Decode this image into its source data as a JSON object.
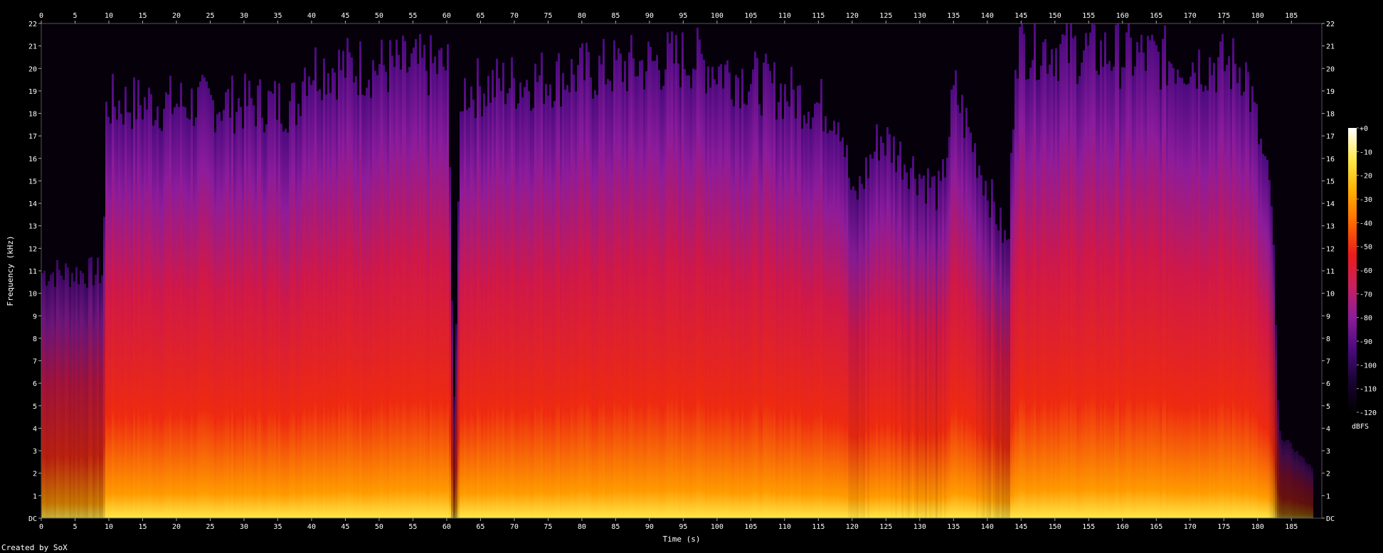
{
  "chart_data": {
    "type": "heatmap",
    "title": "",
    "xlabel": "Time (s)",
    "ylabel": "Frequency (kHz)",
    "xlim": [
      0,
      189.5
    ],
    "ylim": [
      0,
      22
    ],
    "x_ticks": [
      "0",
      "5",
      "10",
      "15",
      "20",
      "25",
      "30",
      "35",
      "40",
      "45",
      "50",
      "55",
      "60",
      "65",
      "70",
      "75",
      "80",
      "85",
      "90",
      "95",
      "100",
      "105",
      "110",
      "115",
      "120",
      "125",
      "130",
      "135",
      "140",
      "145",
      "150",
      "155",
      "160",
      "165",
      "170",
      "175",
      "180",
      "185"
    ],
    "y_ticks": [
      "DC",
      "1",
      "2",
      "3",
      "4",
      "5",
      "6",
      "7",
      "8",
      "9",
      "10",
      "11",
      "12",
      "13",
      "14",
      "15",
      "16",
      "17",
      "18",
      "19",
      "20",
      "21",
      "22"
    ],
    "colorbar": {
      "label": "dBFS",
      "ticks": [
        "+0",
        "-10",
        "-20",
        "-30",
        "-40",
        "-50",
        "-60",
        "-70",
        "-80",
        "-90",
        "-100",
        "-110",
        "-120"
      ],
      "range": [
        -120,
        0
      ]
    },
    "energy_profile": [
      {
        "t": 0,
        "level": 0.45
      },
      {
        "t": 9,
        "level": 0.45
      },
      {
        "t": 9.5,
        "level": 0.82
      },
      {
        "t": 38,
        "level": 0.82
      },
      {
        "t": 38.5,
        "level": 0.9
      },
      {
        "t": 60,
        "level": 0.9
      },
      {
        "t": 61,
        "level": 0.15
      },
      {
        "t": 62,
        "level": 0.85
      },
      {
        "t": 96,
        "level": 0.92
      },
      {
        "t": 118,
        "level": 0.8
      },
      {
        "t": 120,
        "level": 0.6
      },
      {
        "t": 124,
        "level": 0.75
      },
      {
        "t": 133,
        "level": 0.62
      },
      {
        "t": 135,
        "level": 0.85
      },
      {
        "t": 143,
        "level": 0.5
      },
      {
        "t": 144,
        "level": 0.95
      },
      {
        "t": 178,
        "level": 0.9
      },
      {
        "t": 182,
        "level": 0.6
      },
      {
        "t": 183,
        "level": 0.1
      },
      {
        "t": 189.5,
        "level": 0
      }
    ],
    "grid": false,
    "colormap": [
      "#000000",
      "#1a0433",
      "#4b0a7e",
      "#8c1c9c",
      "#c8205e",
      "#ee1a1a",
      "#ff6a00",
      "#ffb000",
      "#ffe84a",
      "#ffffff"
    ]
  },
  "credit": "Created by SoX"
}
